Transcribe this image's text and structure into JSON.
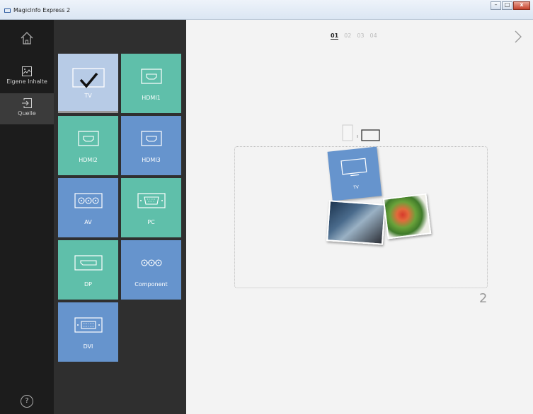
{
  "window": {
    "title": "MagicInfo Express 2",
    "buttons": {
      "minimize": "–",
      "maximize": "□",
      "close": "x"
    }
  },
  "rail": {
    "items": [
      {
        "label": "Eigene Inhalte",
        "icon": "image-icon"
      },
      {
        "label": "Quelle",
        "icon": "input-source-icon"
      }
    ],
    "help": "?"
  },
  "sources": [
    {
      "label": "TV",
      "icon": "tv-icon",
      "color": "#b7cbe6",
      "selected": true
    },
    {
      "label": "HDMI1",
      "icon": "hdmi-icon",
      "color": "#5fbfaa"
    },
    {
      "label": "HDMI2",
      "icon": "hdmi-icon",
      "color": "#5fbfaa"
    },
    {
      "label": "HDMI3",
      "icon": "hdmi-icon",
      "color": "#6694cd"
    },
    {
      "label": "AV",
      "icon": "av-icon",
      "color": "#6694cd"
    },
    {
      "label": "PC",
      "icon": "vga-icon",
      "color": "#5fbfaa"
    },
    {
      "label": "DP",
      "icon": "displayport-icon",
      "color": "#5fbfaa"
    },
    {
      "label": "Component",
      "icon": "component-icon",
      "color": "#6694cd"
    },
    {
      "label": "DVI",
      "icon": "dvi-icon",
      "color": "#6694cd"
    }
  ],
  "pager": {
    "pages": [
      "01",
      "02",
      "03",
      "04"
    ],
    "active": "01"
  },
  "canvas": {
    "tv_card_label": "TV",
    "page_number": "2"
  },
  "colors": {
    "teal": "#5fbfaa",
    "blue": "#6694cd",
    "selected": "#b7cbe6",
    "rail": "#1c1c1c",
    "panel": "#2f2f2f"
  }
}
